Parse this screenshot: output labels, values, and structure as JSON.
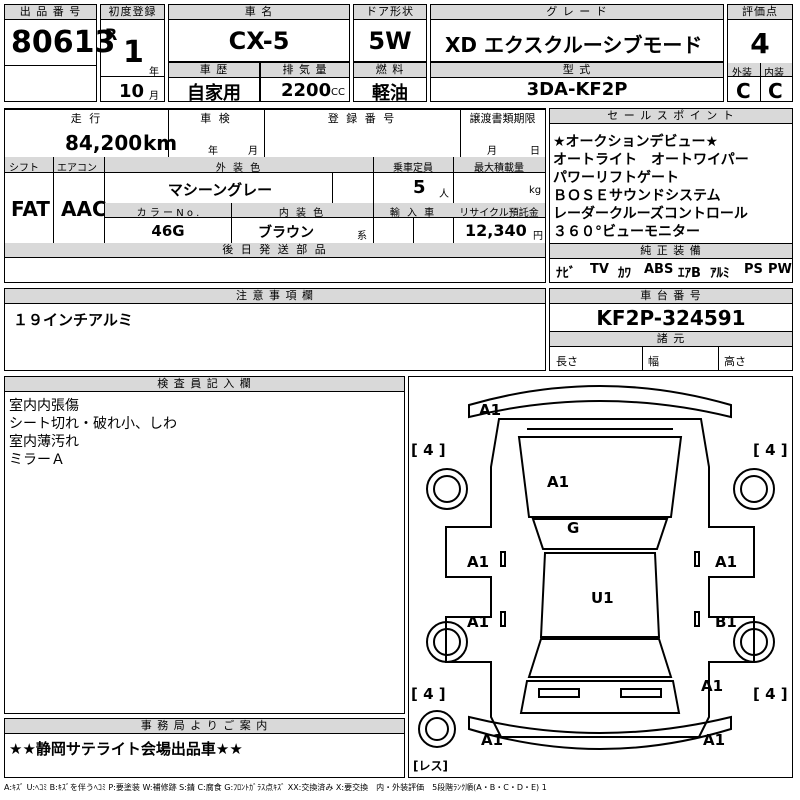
{
  "lot": {
    "label": "出 品 番 号",
    "value": "80613"
  },
  "first_reg": {
    "label": "初度登録",
    "era": "R",
    "year": "1",
    "year_unit": "年",
    "month": "10",
    "month_unit": "月"
  },
  "car_name": {
    "label": "車 名",
    "value": "CX-5"
  },
  "door": {
    "label": "ドア形状",
    "value": "5W"
  },
  "grade": {
    "label": "グ レ ー ド",
    "value": "XD エクスクルーシブモード"
  },
  "score": {
    "label": "評価点",
    "value": "4",
    "ext_label": "外装",
    "int_label": "内装",
    "ext_value": "C",
    "int_value": "C"
  },
  "history": {
    "label": "車 歴",
    "value": "自家用"
  },
  "displacement": {
    "label": "排 気 量",
    "value": "2200",
    "unit": "CC"
  },
  "fuel": {
    "label": "燃 料",
    "value": "軽油"
  },
  "model": {
    "label": "型 式",
    "value": "3DA-KF2P"
  },
  "mileage": {
    "label": "走 行",
    "value": "84,200",
    "unit": "km"
  },
  "inspection": {
    "label": "車 検",
    "year_unit": "年",
    "month_unit": "月"
  },
  "reg_no": {
    "label": "登 録 番 号"
  },
  "transfer": {
    "label": "譲渡書類期限",
    "month_unit": "月",
    "day_unit": "日"
  },
  "shift": {
    "label": "シフト",
    "value": "FAT"
  },
  "aircon": {
    "label": "エアコン",
    "value": "AAC"
  },
  "ext_color": {
    "label": "外 装 色",
    "value": "マシーングレー"
  },
  "capacity": {
    "label": "乗車定員",
    "value": "5",
    "unit": "人"
  },
  "max_load": {
    "label": "最大積載量",
    "unit": "kg"
  },
  "color_no": {
    "label": "カ ラ ー  N o .",
    "value": "46G"
  },
  "int_color": {
    "label": "内 装 色",
    "value": "ブラウン",
    "suffix": "系"
  },
  "import": {
    "label": "輸 入 車"
  },
  "recycle": {
    "label": "リサイクル預託金",
    "value": "12,340",
    "unit": "円"
  },
  "later_parts": {
    "label": "後 日 発 送 部 品"
  },
  "sales_points": {
    "label": "セ ー ル ス ポ イ ン ト",
    "lines": [
      "★オークションデビュー★",
      "オートライト　オートワイパー",
      "パワーリフトゲート",
      "ＢＯＳＥサウンドシステム",
      "レーダークルーズコントロール",
      "３６０°ビューモニター"
    ]
  },
  "equipment": {
    "label": "純 正 装 備",
    "items": [
      "ﾅﾋﾞ",
      "TV",
      "ｶﾜ",
      "ABS",
      "ｴｱB",
      "ｱﾙﾐ",
      "PS",
      "PW"
    ]
  },
  "notes": {
    "label": "注 意 事 項 欄",
    "value": "１９インチアルミ"
  },
  "chassis": {
    "label": "車 台 番 号",
    "value": "KF2P-324591"
  },
  "dims": {
    "label": "諸 元",
    "length": "長さ",
    "width": "幅",
    "height": "高さ"
  },
  "inspector": {
    "label": "検 査 員 記 入 欄",
    "lines": [
      "室内内張傷",
      "シート切れ・破れ小、しわ",
      "室内薄汚れ",
      "ミラーＡ"
    ]
  },
  "office": {
    "label": "事 務 局 よ り ご 案 内",
    "value": "★★静岡サテライト会場出品車★★"
  },
  "diagram": {
    "marks": {
      "front_left_bumper": "A1",
      "hood": "A1",
      "roof": "G",
      "left_front": "A1",
      "right_front": "A1",
      "left_rear": "A1",
      "right_rear": "B1",
      "center": "U1",
      "rear_right_corner": "A1",
      "rear_left_bottom": "A1",
      "rear_right_bottom": "A1"
    },
    "tires": {
      "fl": "4",
      "fr": "4",
      "rl": "4",
      "rr": "4",
      "spare": "レス"
    }
  },
  "legend": "A:ｷｽﾞ U:ﾍｺﾐ B:ｷｽﾞを伴うﾍｺﾐ P:要塗装 W:補修跡 S:錆 C:腐食 G:ﾌﾛﾝﾄｶﾞﾗｽ点ｷｽﾞ XX:交換済み X:要交換　内・外装評価　5段階ﾗﾝｸ順(A・B・C・D・E) 1"
}
